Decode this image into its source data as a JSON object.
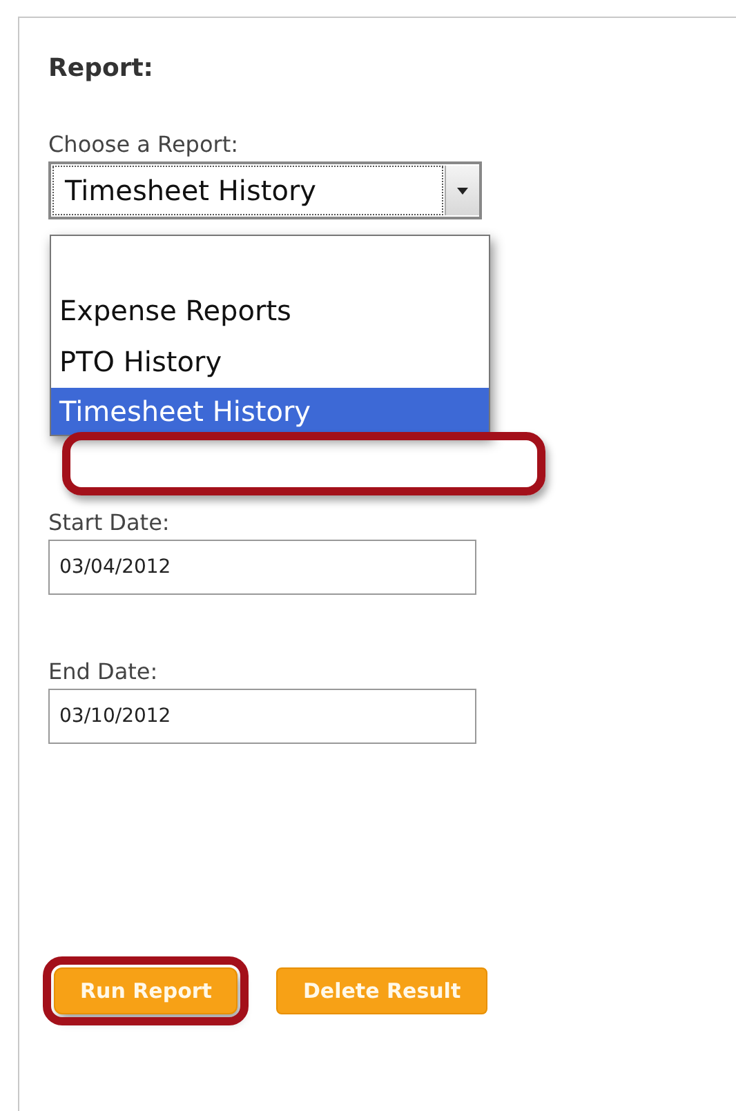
{
  "panel": {
    "title": "Report:",
    "report_field": {
      "label": "Choose a Report:",
      "value": "Timesheet History",
      "expanded": true,
      "highlighted": true,
      "options": [
        {
          "label": "Expense Reports",
          "selected": false
        },
        {
          "label": "PTO History",
          "selected": false
        },
        {
          "label": "Timesheet History",
          "selected": true
        }
      ]
    },
    "start_date": {
      "label": "Start Date:",
      "value": "03/04/2012"
    },
    "end_date": {
      "label": "End Date:",
      "value": "03/10/2012"
    },
    "buttons": [
      {
        "label": "Run Report",
        "highlighted": true
      },
      {
        "label": "Delete Result",
        "highlighted": false
      }
    ]
  }
}
